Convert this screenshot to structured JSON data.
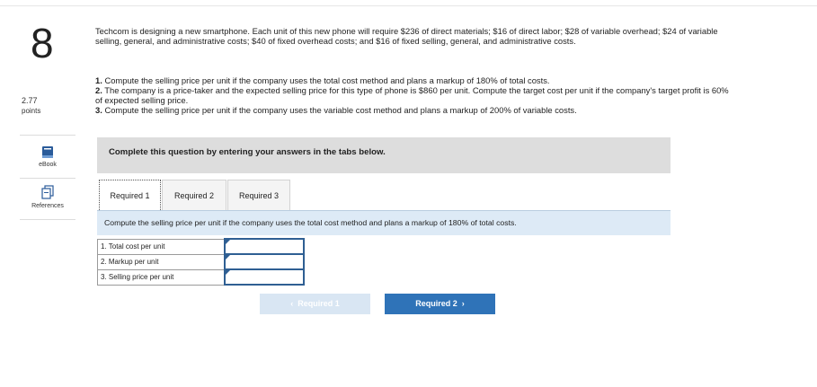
{
  "question": {
    "number": "8",
    "points_value": "2.77",
    "points_label": "points",
    "text": "Techcom is designing a new smartphone. Each unit of this new phone will require $236 of direct materials; $16 of direct labor; $28 of variable overhead; $24 of variable selling, general, and administrative costs; $40 of fixed overhead costs; and $16 of fixed selling, general, and administrative costs."
  },
  "sidebar": {
    "ebook_label": "eBook",
    "references_label": "References"
  },
  "requirements": [
    {
      "num": "1.",
      "text": "Compute the selling price per unit if the company uses the total cost method and plans a markup of 180% of total costs."
    },
    {
      "num": "2.",
      "text": "The company is a price-taker and the expected selling price for this type of phone is $860 per unit. Compute the target cost per unit if the company's target profit is 60% of expected selling price."
    },
    {
      "num": "3.",
      "text": "Compute the selling price per unit if the company uses the variable cost method and plans a markup of 200% of variable costs."
    }
  ],
  "instruction": "Complete this question by entering your answers in the tabs below.",
  "tabs": [
    {
      "label": "Required 1",
      "active": true
    },
    {
      "label": "Required 2",
      "active": false
    },
    {
      "label": "Required 3",
      "active": false
    }
  ],
  "prompt": "Compute the selling price per unit if the company uses the total cost method and plans a markup of 180% of total costs.",
  "answer_rows": [
    {
      "label": "1. Total cost per unit",
      "value": ""
    },
    {
      "label": "2. Markup per unit",
      "value": ""
    },
    {
      "label": "3. Selling price per unit",
      "value": ""
    }
  ],
  "nav": {
    "prev_label": "Required 1",
    "next_label": "Required 2"
  },
  "colors": {
    "accent": "#2f73b8",
    "prompt_band": "#ddeaf6",
    "instruction_band": "#dddddd"
  }
}
